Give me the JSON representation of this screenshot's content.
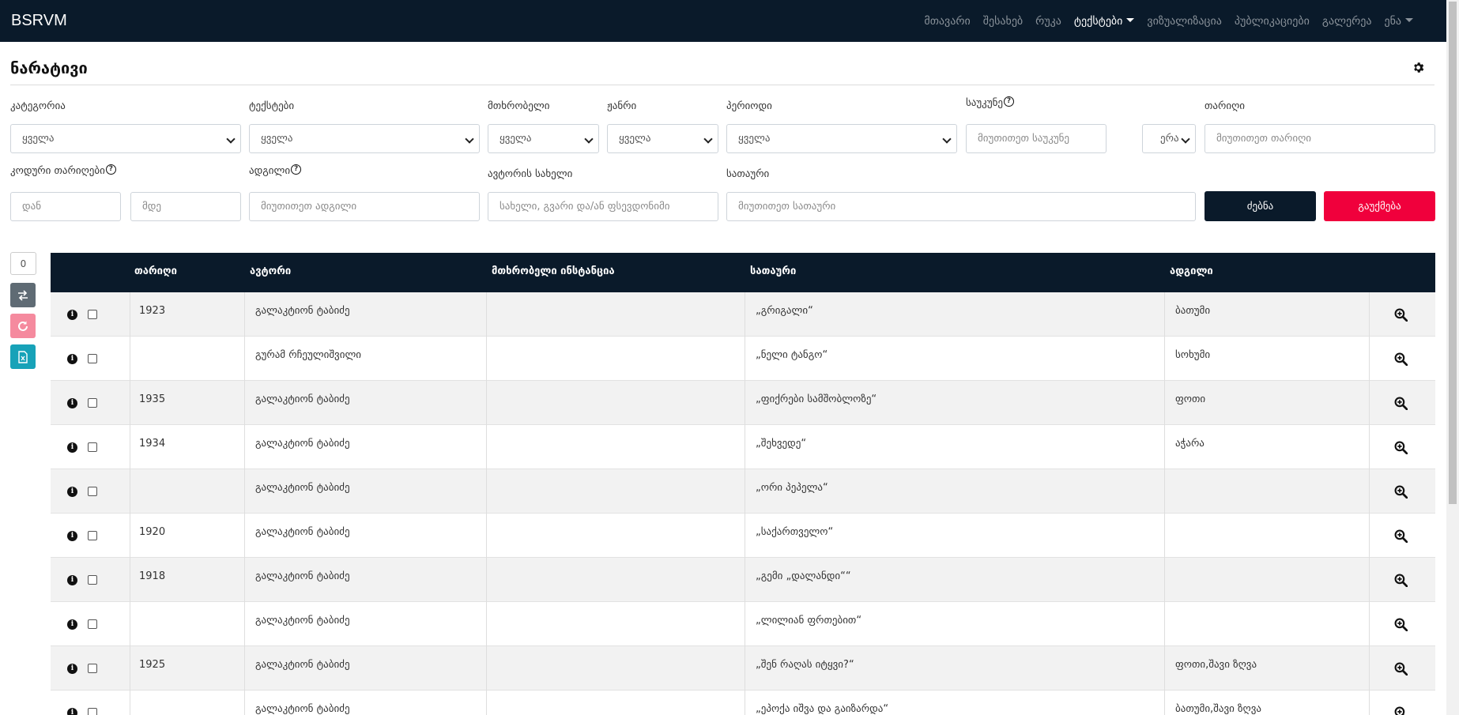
{
  "navbar": {
    "brand": "BSRVM",
    "links": [
      {
        "label": "მთავარი"
      },
      {
        "label": "შესახებ"
      },
      {
        "label": "რუკა"
      },
      {
        "label": "ტექსტები"
      },
      {
        "label": "ვიზუალიზაცია"
      },
      {
        "label": "პუბლიკაციები"
      },
      {
        "label": "გალერეა"
      },
      {
        "label": "ენა"
      }
    ]
  },
  "page": {
    "title": "ნარატივი"
  },
  "filters": {
    "category_label": "კატეგორია",
    "category_value": "ყველა",
    "texts_label": "ტექსტები",
    "texts_value": "ყველა",
    "narrator_label": "მთხრობელი",
    "narrator_value": "ყველა",
    "genre_label": "ჟანრი",
    "genre_value": "ყველა",
    "period_label": "პერიოდი",
    "period_value": "ყველა",
    "century_label": "საუკუნე",
    "century_placeholder": "მიუთითეთ საუკუნე",
    "era_value": "ერა",
    "date_label": "თარიღი",
    "date_placeholder": "მიუთითეთ თარიღი",
    "coded_dates_label": "კოდური თარიღები",
    "from_placeholder": "დან",
    "to_placeholder": "მდე",
    "place_label": "ადგილი",
    "place_placeholder": "მიუთითეთ ადგილი",
    "author_name_label": "ავტორის სახელი",
    "author_name_placeholder": "სახელი, გვარი და/ან ფსევდონიმი",
    "title_label": "სათაური",
    "title_placeholder": "მიუთითეთ სათაური",
    "search_button": "ძებნა",
    "cancel_button": "გაუქმება",
    "help_glyph": "?"
  },
  "sidebar": {
    "count": "0"
  },
  "table": {
    "headers": {
      "date": "თარიღი",
      "author": "ავტორი",
      "narrator_instance": "მთხრობელი ინსტანცია",
      "title": "სათაური",
      "place": "ადგილი"
    },
    "info_glyph": "i",
    "rows": [
      {
        "date": "1923",
        "author": "გალაკტიონ ტაბიძე",
        "narrator": "",
        "title": "„გრიგალი“",
        "place": "ბათუმი"
      },
      {
        "date": "",
        "author": "გურამ რჩეულიშვილი",
        "narrator": "",
        "title": "„ნელი ტანგო“",
        "place": "სოხუმი"
      },
      {
        "date": "1935",
        "author": "გალაკტიონ ტაბიძე",
        "narrator": "",
        "title": "„ფიქრები სამშობლოზე“",
        "place": "ფოთი"
      },
      {
        "date": "1934",
        "author": "გალაკტიონ ტაბიძე",
        "narrator": "",
        "title": "„შეხვედე“",
        "place": "აჭარა"
      },
      {
        "date": "",
        "author": "გალაკტიონ ტაბიძე",
        "narrator": "",
        "title": "„ორი პეპელა“",
        "place": ""
      },
      {
        "date": "1920",
        "author": "გალაკტიონ ტაბიძე",
        "narrator": "",
        "title": "„საქართველო“",
        "place": ""
      },
      {
        "date": "1918",
        "author": "გალაკტიონ ტაბიძე",
        "narrator": "",
        "title": "„გემი „დალანდი““",
        "place": ""
      },
      {
        "date": "",
        "author": "გალაკტიონ ტაბიძე",
        "narrator": "",
        "title": "„ლილიან ფრთებით“",
        "place": ""
      },
      {
        "date": "1925",
        "author": "გალაკტიონ ტაბიძე",
        "narrator": "",
        "title": "„შენ რაღას იტყვი?“",
        "place": "ფოთი,შავი ზღვა"
      },
      {
        "date": "",
        "author": "გალაკტიონ ტაბიძე",
        "narrator": "",
        "title": "„ეპოქა იშვა და გაიზარდა“",
        "place": "ბათუმი,შავი ზღვა"
      }
    ]
  }
}
